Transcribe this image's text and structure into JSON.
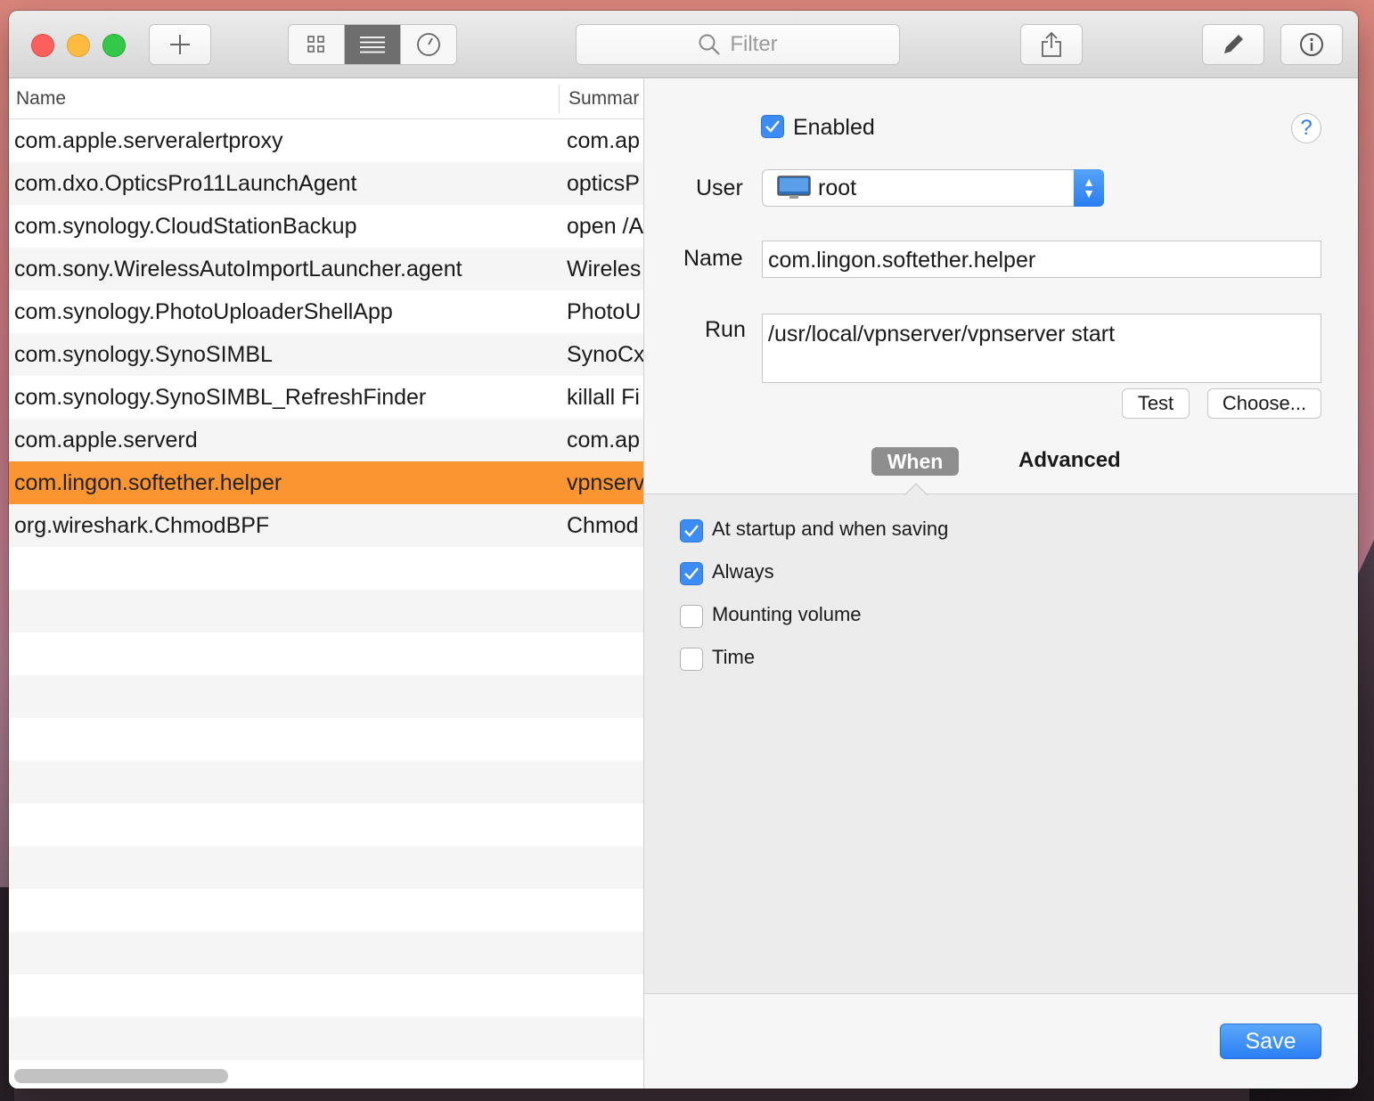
{
  "toolbar": {
    "filter_placeholder": "Filter"
  },
  "list": {
    "columns": [
      "Name",
      "Summar"
    ],
    "rows": [
      {
        "name": "com.apple.serveralertproxy",
        "summary": "com.ap"
      },
      {
        "name": "com.dxo.OpticsPro11LaunchAgent",
        "summary": "opticsP"
      },
      {
        "name": "com.synology.CloudStationBackup",
        "summary": "open /A"
      },
      {
        "name": "com.sony.WirelessAutoImportLauncher.agent",
        "summary": "Wireles"
      },
      {
        "name": "com.synology.PhotoUploaderShellApp",
        "summary": "PhotoU"
      },
      {
        "name": "com.synology.SynoSIMBL",
        "summary": "SynoCx"
      },
      {
        "name": "com.synology.SynoSIMBL_RefreshFinder",
        "summary": "killall Fi"
      },
      {
        "name": "com.apple.serverd",
        "summary": "com.ap"
      },
      {
        "name": "com.lingon.softether.helper",
        "summary": "vpnserv"
      },
      {
        "name": "org.wireshark.ChmodBPF",
        "summary": "Chmod"
      }
    ],
    "selected_index": 8
  },
  "detail": {
    "enabled_label": "Enabled",
    "enabled": true,
    "help_glyph": "?",
    "user_label": "User",
    "user_value": "root",
    "name_label": "Name",
    "name_value": "com.lingon.softether.helper",
    "run_label": "Run",
    "run_value": "/usr/local/vpnserver/vpnserver start",
    "test_button": "Test",
    "choose_button": "Choose...",
    "tabs": {
      "when": "When",
      "advanced": "Advanced"
    },
    "when_options": [
      {
        "label": "At startup and when saving",
        "checked": true
      },
      {
        "label": "Always",
        "checked": true
      },
      {
        "label": "Mounting volume",
        "checked": false
      },
      {
        "label": "Time",
        "checked": false
      }
    ],
    "save_button": "Save"
  },
  "colors": {
    "selection": "#fb9530",
    "accent": "#3b8cf5"
  }
}
